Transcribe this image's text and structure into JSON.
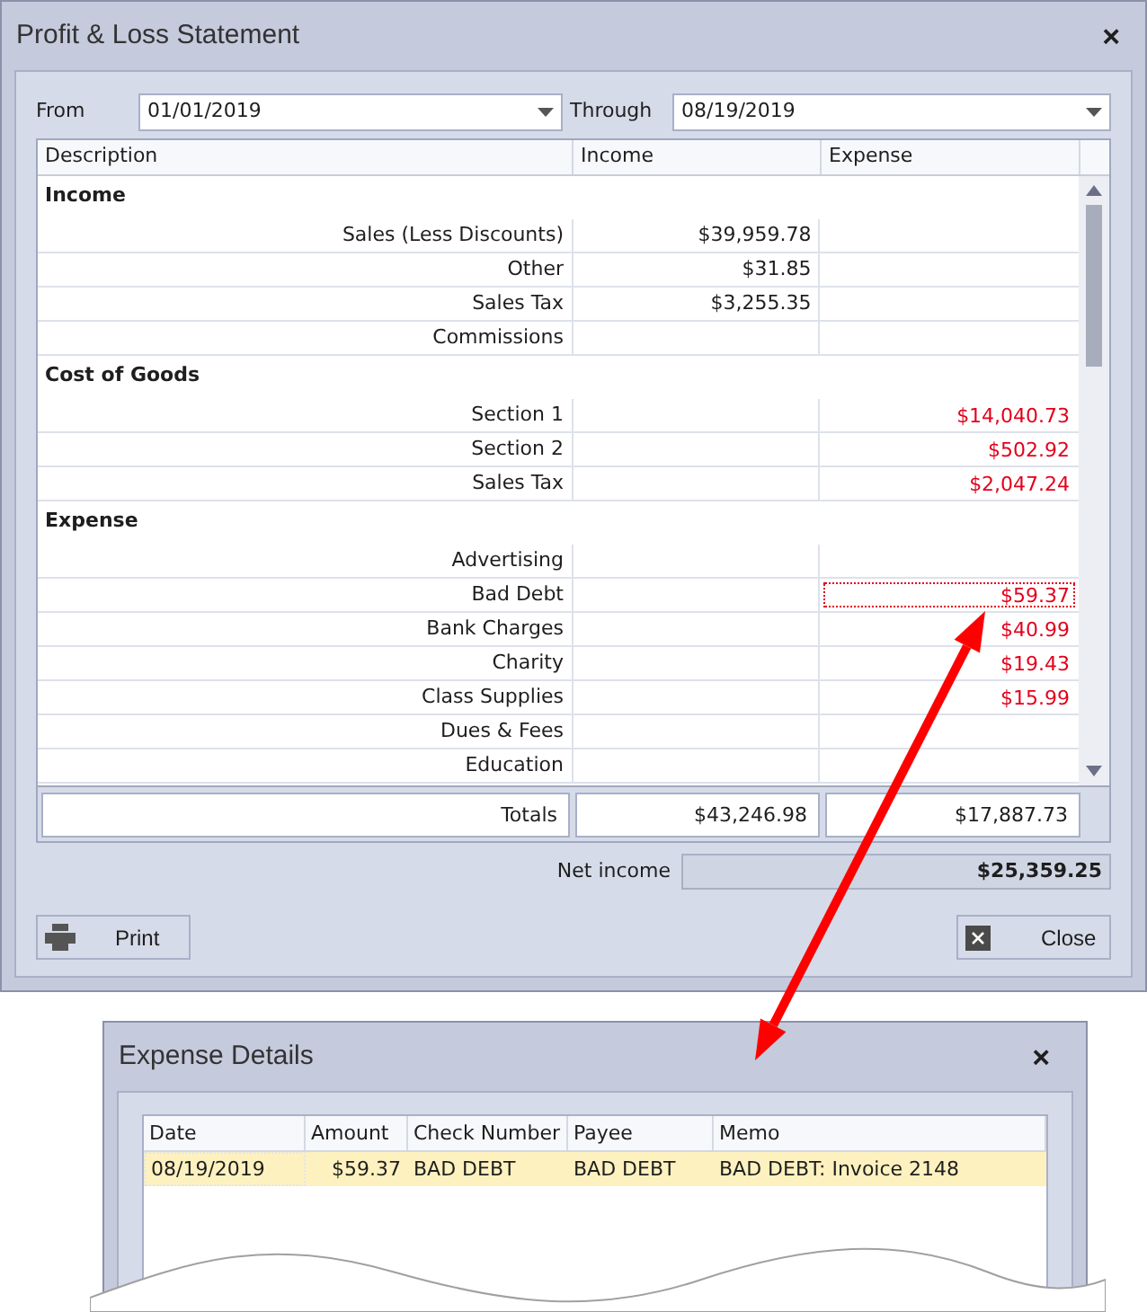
{
  "window": {
    "title": "Profit & Loss Statement",
    "close": "×"
  },
  "filters": [
    {
      "label": "From",
      "value": "01/01/2019"
    },
    {
      "label": "Through",
      "value": "08/19/2019"
    }
  ],
  "grid": {
    "columns": [
      "Description",
      "Income",
      "Expense"
    ],
    "sections": [
      {
        "title": "Income",
        "rows": [
          {
            "description": "Sales (Less Discounts)",
            "income": "$39,959.78",
            "expense": "",
            "focused": false
          },
          {
            "description": "Other",
            "income": "$31.85",
            "expense": "",
            "focused": false
          },
          {
            "description": "Sales Tax",
            "income": "$3,255.35",
            "expense": "",
            "focused": false
          },
          {
            "description": "Commissions",
            "income": "",
            "expense": "",
            "focused": false
          }
        ]
      },
      {
        "title": "Cost of Goods",
        "rows": [
          {
            "description": "Section 1",
            "income": "",
            "expense": "$14,040.73",
            "focused": false
          },
          {
            "description": "Section 2",
            "income": "",
            "expense": "$502.92",
            "focused": false
          },
          {
            "description": "Sales Tax",
            "income": "",
            "expense": "$2,047.24",
            "focused": false
          }
        ]
      },
      {
        "title": "Expense",
        "rows": [
          {
            "description": "Advertising",
            "income": "",
            "expense": "",
            "focused": false
          },
          {
            "description": "Bad Debt",
            "income": "",
            "expense": "$59.37",
            "focused": true
          },
          {
            "description": "Bank Charges",
            "income": "",
            "expense": "$40.99",
            "focused": false
          },
          {
            "description": "Charity",
            "income": "",
            "expense": "$19.43",
            "focused": false
          },
          {
            "description": "Class Supplies",
            "income": "",
            "expense": "$15.99",
            "focused": false
          },
          {
            "description": "Dues & Fees",
            "income": "",
            "expense": "",
            "focused": false
          },
          {
            "description": "Education",
            "income": "",
            "expense": "",
            "focused": false
          }
        ]
      }
    ],
    "totals": {
      "label": "Totals",
      "income": "$43,246.98",
      "expense": "$17,887.73"
    }
  },
  "net_income": {
    "label": "Net income",
    "value": "$25,359.25"
  },
  "buttons": [
    {
      "kind": "print",
      "label": "Print"
    },
    {
      "kind": "close",
      "label": "Close"
    }
  ],
  "details_window": {
    "title": "Expense Details",
    "close": "×",
    "columns": [
      "Date",
      "Amount",
      "Check Number",
      "Payee",
      "Memo"
    ],
    "rows": [
      {
        "date": "08/19/2019",
        "amount": "$59.37",
        "check_number": "BAD DEBT",
        "payee": "BAD DEBT",
        "memo": "BAD DEBT: Invoice 2148",
        "selected": true
      }
    ]
  }
}
